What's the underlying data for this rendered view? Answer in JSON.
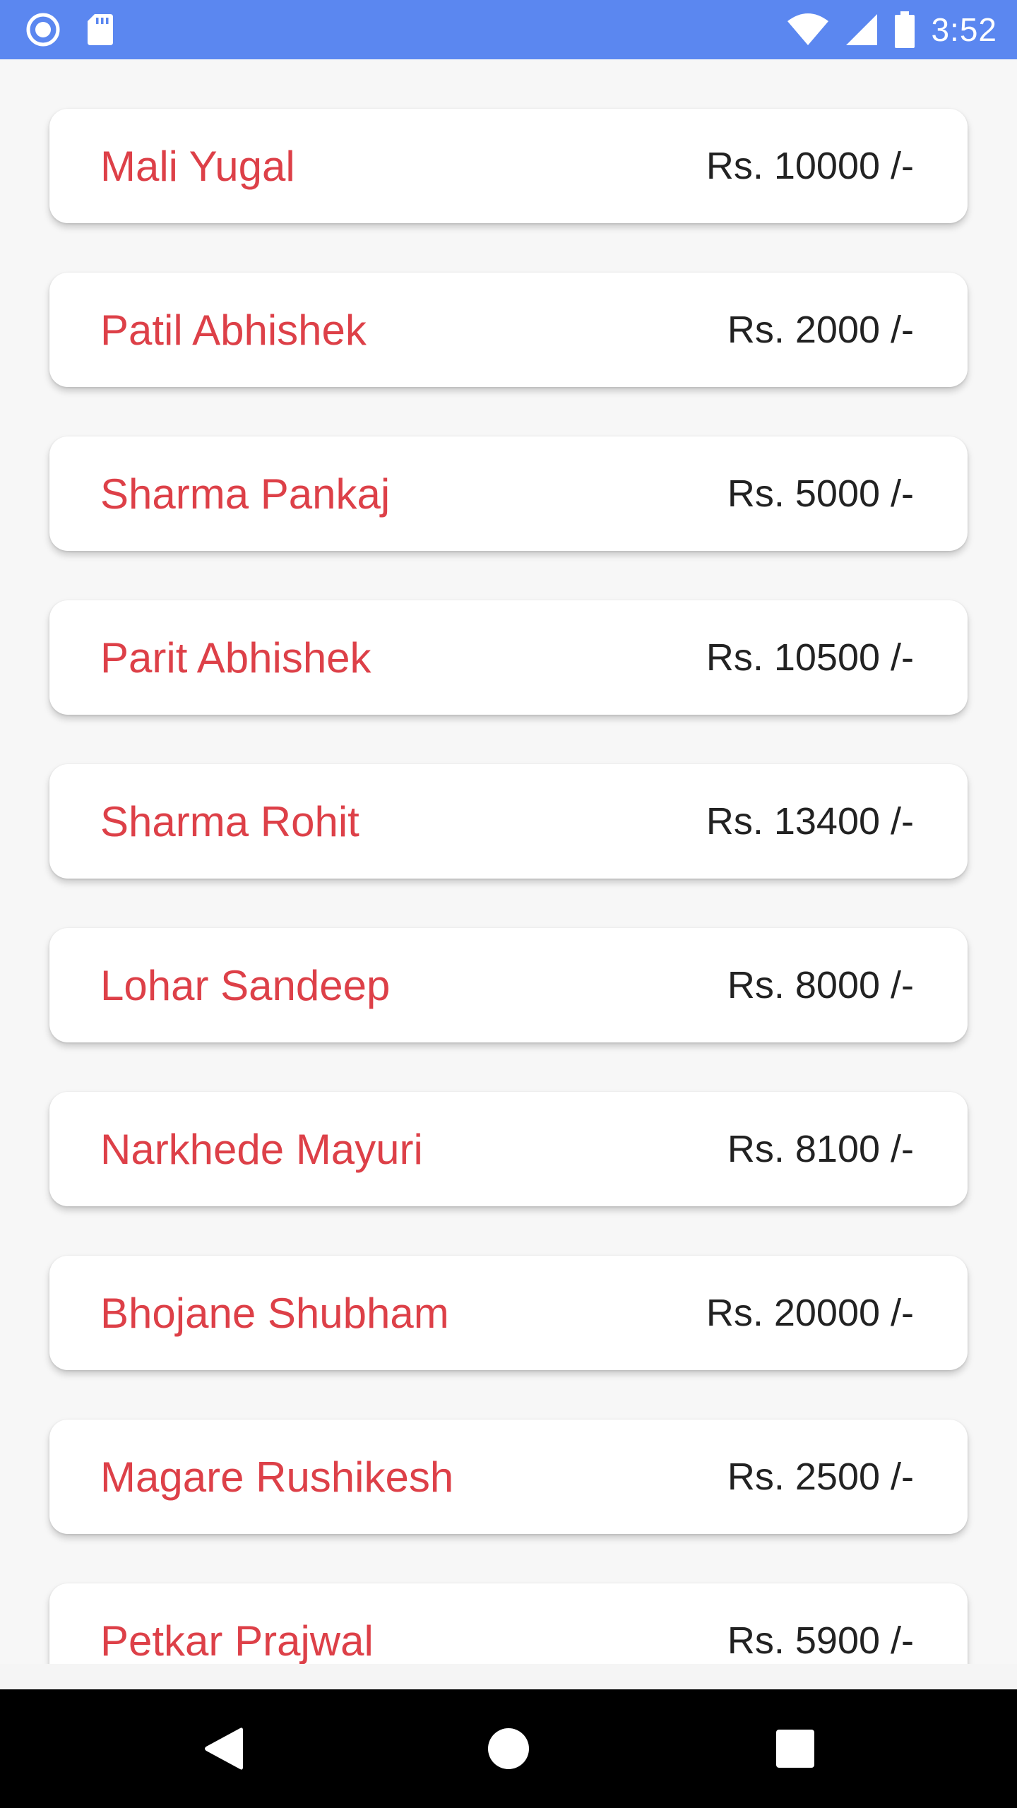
{
  "status_bar": {
    "time": "3:52",
    "icons": [
      "notification-dot-icon",
      "sd-card-icon",
      "wifi-icon",
      "cellular-signal-icon",
      "battery-icon"
    ]
  },
  "colors": {
    "status_bar": "#5b87f0",
    "name_text": "#dd4048",
    "amount_text": "#222222",
    "card_background": "#ffffff",
    "page_background": "#f7f7f7",
    "nav_bar": "#000000"
  },
  "entries": [
    {
      "name": "Mali Yugal",
      "amount": "Rs. 10000 /-"
    },
    {
      "name": "Patil Abhishek",
      "amount": "Rs. 2000 /-"
    },
    {
      "name": "Sharma Pankaj",
      "amount": "Rs. 5000 /-"
    },
    {
      "name": "Parit Abhishek",
      "amount": "Rs. 10500 /-"
    },
    {
      "name": "Sharma Rohit",
      "amount": "Rs. 13400 /-"
    },
    {
      "name": "Lohar Sandeep",
      "amount": "Rs. 8000 /-"
    },
    {
      "name": "Narkhede Mayuri",
      "amount": "Rs. 8100 /-"
    },
    {
      "name": "Bhojane Shubham",
      "amount": "Rs. 20000 /-"
    },
    {
      "name": "Magare Rushikesh",
      "amount": "Rs. 2500 /-"
    },
    {
      "name": "Petkar Prajwal",
      "amount": "Rs. 5900 /-"
    }
  ],
  "nav_bar": {
    "icons": [
      "back-icon",
      "home-icon",
      "recents-icon"
    ]
  }
}
